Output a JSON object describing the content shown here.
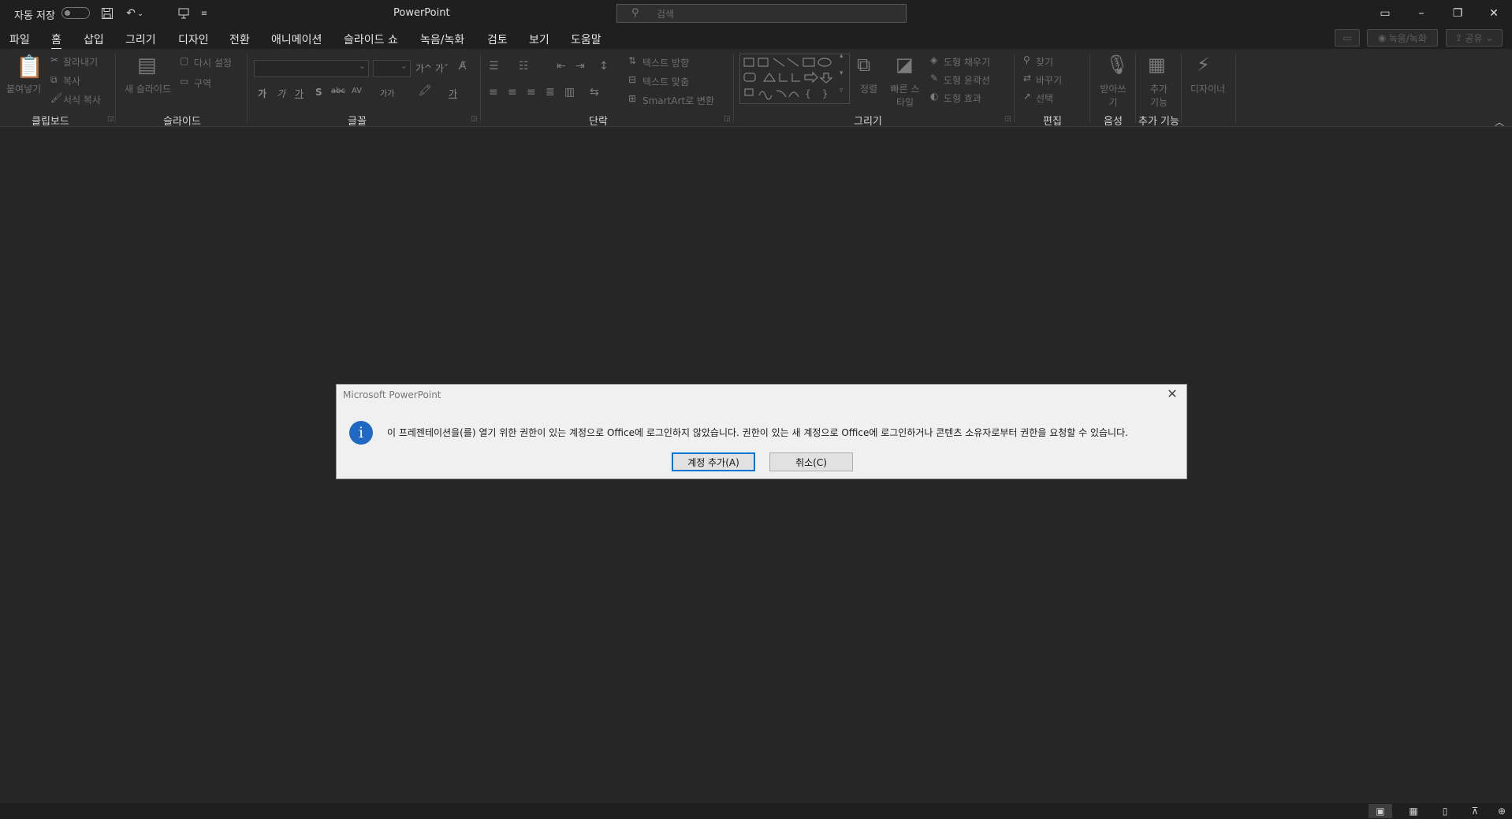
{
  "titlebar": {
    "autosave_label": "자동 저장",
    "app_title": "PowerPoint",
    "search_placeholder": "검색"
  },
  "menu": {
    "tabs": [
      "파일",
      "홈",
      "삽입",
      "그리기",
      "디자인",
      "전환",
      "애니메이션",
      "슬라이드 쇼",
      "녹음/녹화",
      "검토",
      "보기",
      "도움말"
    ],
    "active_tab": "홈",
    "record_button": "녹음/녹화",
    "share_button": "공유"
  },
  "ribbon": {
    "clipboard": {
      "label": "클립보드",
      "paste": "붙여넣기",
      "cut": "잘라내기",
      "copy": "복사",
      "format_painter": "서식 복사"
    },
    "slides": {
      "label": "슬라이드",
      "new_slide": "새 슬라이드",
      "reset": "다시 설정",
      "section": "구역"
    },
    "font": {
      "label": "글꼴",
      "bold": "가",
      "italic": "가",
      "underline": "가",
      "shadow": "S",
      "strike": "abc",
      "spacing": "AV",
      "case": "가가",
      "grow": "가^",
      "shrink": "가ˇ",
      "color": "가"
    },
    "paragraph": {
      "label": "단락",
      "text_direction": "텍스트 방향",
      "align_text": "텍스트 맞춤",
      "smartart": "SmartArt로 변환"
    },
    "drawing": {
      "label": "그리기",
      "arrange": "정렬",
      "quick_styles": "빠른 스타일",
      "shape_fill": "도형 채우기",
      "shape_outline": "도형 윤곽선",
      "shape_effects": "도형 효과"
    },
    "editing": {
      "label": "편집",
      "find": "찾기",
      "replace": "바꾸기",
      "select": "선택"
    },
    "voice": {
      "label": "음성",
      "dictate": "받아쓰기"
    },
    "addins": {
      "label": "추가 기능",
      "addins_button": "추가 기능"
    },
    "designer": {
      "button": "디자이너"
    }
  },
  "dialog": {
    "title": "Microsoft PowerPoint",
    "message": "이 프레젠테이션을(를) 열기 위한 권한이 있는 계정으로 Office에 로그인하지 않았습니다. 권한이 있는 새 계정으로 Office에 로그인하거나 콘텐츠 소유자로부터 권한을 요청할 수 있습니다.",
    "primary_button": "계정 추가(A)",
    "cancel_button": "취소(C)",
    "info_glyph": "i"
  },
  "colors": {
    "background": "#262626",
    "titlebar": "#1f1f1f",
    "dialog_bg": "#f0f0f0",
    "info_blue": "#1f68c3",
    "primary_border": "#0078d7"
  }
}
